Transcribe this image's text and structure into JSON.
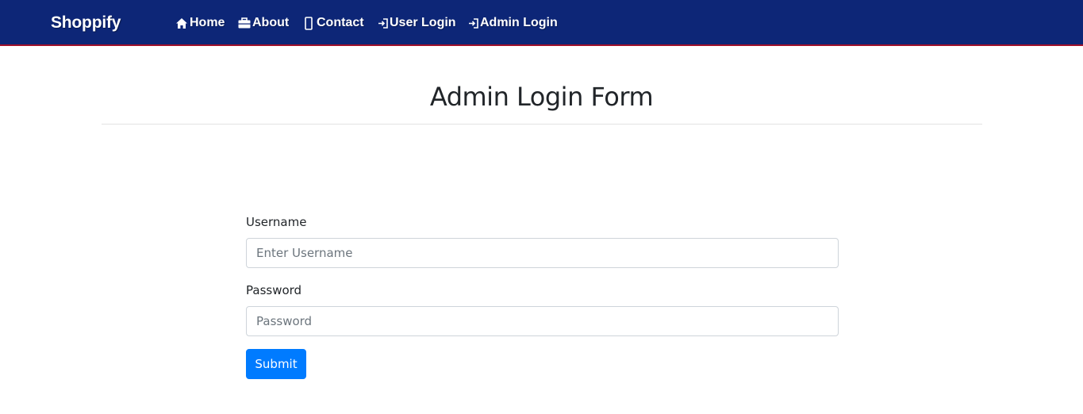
{
  "navbar": {
    "brand": "Shoppify",
    "background": "#0d2677",
    "accent_border": "#a0102a",
    "links": [
      {
        "label": "Home",
        "icon": "home-icon"
      },
      {
        "label": "About",
        "icon": "briefcase-icon"
      },
      {
        "label": "Contact",
        "icon": "mobile-phone-icon"
      },
      {
        "label": "User Login",
        "icon": "login-icon"
      },
      {
        "label": "Admin Login",
        "icon": "login-icon"
      }
    ]
  },
  "main": {
    "title": "Admin Login Form",
    "form": {
      "username_label": "Username",
      "username_placeholder": "Enter Username",
      "username_value": "",
      "password_label": "Password",
      "password_placeholder": "Password",
      "password_value": "",
      "submit_label": "Submit",
      "submit_color": "#007bff"
    }
  }
}
